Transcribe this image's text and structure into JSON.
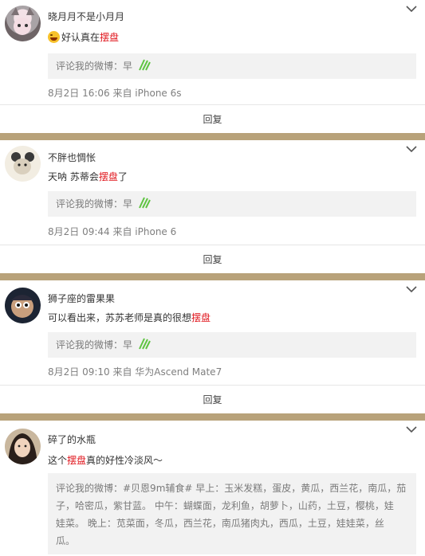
{
  "comments": [
    {
      "author": "晓月月不是小月月",
      "body_pre": "好认真在",
      "body_hl": "摆盘",
      "body_post": "",
      "quote_label": "评论我的微博：",
      "quote_text": "早",
      "meta": "8月2日 16:06 来自 iPhone 6s",
      "reply_label": "回复"
    },
    {
      "author": "不胖也惆怅",
      "body_pre": "天呐 苏蒂会",
      "body_hl": "摆盘",
      "body_post": "了",
      "quote_label": "评论我的微博：",
      "quote_text": "早",
      "meta": "8月2日 09:44 来自 iPhone 6",
      "reply_label": "回复"
    },
    {
      "author": "狮子座的雷果果",
      "body_pre": "可以看出来，苏苏老师是真的很想",
      "body_hl": "摆盘",
      "body_post": "",
      "quote_label": "评论我的微博：",
      "quote_text": "早",
      "meta": "8月2日 09:10 来自 华为Ascend Mate7",
      "reply_label": "回复"
    },
    {
      "author": "碎了的水瓶",
      "body_pre": "这个",
      "body_hl": "摆盘",
      "body_post": "真的好性冷淡风～",
      "quote_lines": [
        "评论我的微博：#贝恩9m辅食# 早上：玉米发糕，蛋皮，黄瓜，西兰花，南瓜，茄",
        "子，哈密瓜，紫甘蓝。 中午：蝴蝶面，龙利鱼，胡萝卜，山药，土豆，樱桃，娃",
        "娃菜。 晚上：苋菜面，冬瓜，西兰花，南瓜猪肉丸，西瓜，土豆，娃娃菜，丝",
        "瓜。"
      ]
    }
  ],
  "icons": {
    "more": "chevron-down-icon",
    "emoji_laugh": "laughing-emoji-icon",
    "emoji_zao": "zao-sticker-icon"
  },
  "colors": {
    "highlight": "#e0161d",
    "separator": "#b8a27a",
    "quote_bg": "#f2f2f2"
  }
}
